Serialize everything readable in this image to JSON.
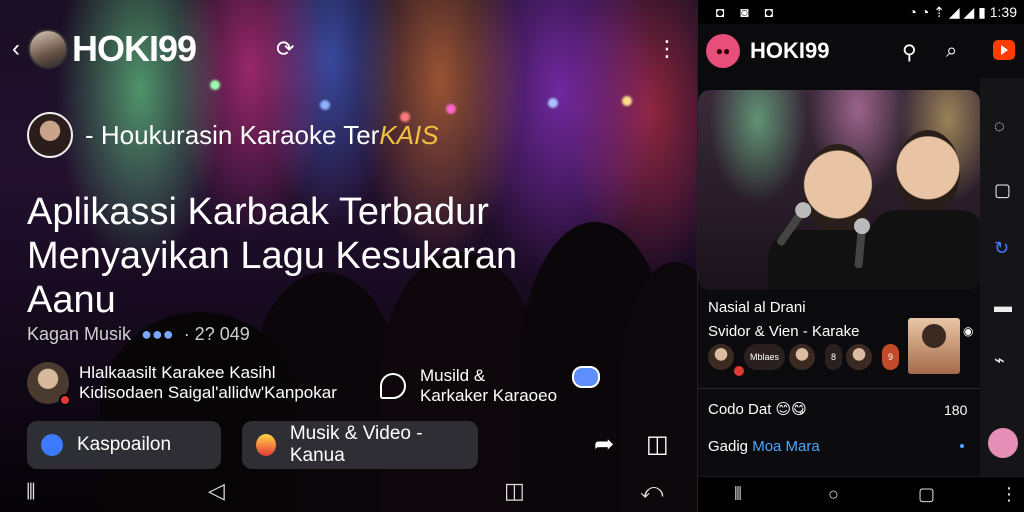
{
  "left": {
    "brand": "HOKI99",
    "subtitle": "- Houkurasin Karaoke Ter",
    "subtitle_deco": "KAIS",
    "headline": "Aplikassi Karbaak Terbadur Menyayikan Lagu Kesukaran Aanu",
    "meta_category": "Kagan Musik",
    "meta_dots": "●●●",
    "meta_count": "· 2? 049",
    "channel_line1": "Hlalkaasilt Karakee Kasihl",
    "channel_line2": "Kidisodaen Saigal'allidw'Kanpokar",
    "tag_line1": "Musild &",
    "tag_line2": "Karkaker Karaoeo",
    "pill1_label": "Kaspoailon",
    "pill2_label": "Musik & Video - Kanua",
    "icons": [
      "back-icon",
      "refresh-icon",
      "more-icon",
      "share-icon",
      "bookmark-icon"
    ]
  },
  "right": {
    "status_left": "◘ ◙ ◘",
    "status_right": "◔ ◔ ⇡ ◢ ◢ ▮  1:39",
    "brand": "HOKI99",
    "card_title_line1": "Nasial al Drani",
    "card_title_line2": "Svidor & Vien - Karake",
    "row1_text": "Codo Dat 😊😋",
    "row1_count": "180",
    "row2_prefix": "Gadig ",
    "row2_highlight": "Moa Mara",
    "mini_pills": [
      "Mblaes",
      "8",
      "9"
    ],
    "accent_color": "#e84e7a"
  }
}
